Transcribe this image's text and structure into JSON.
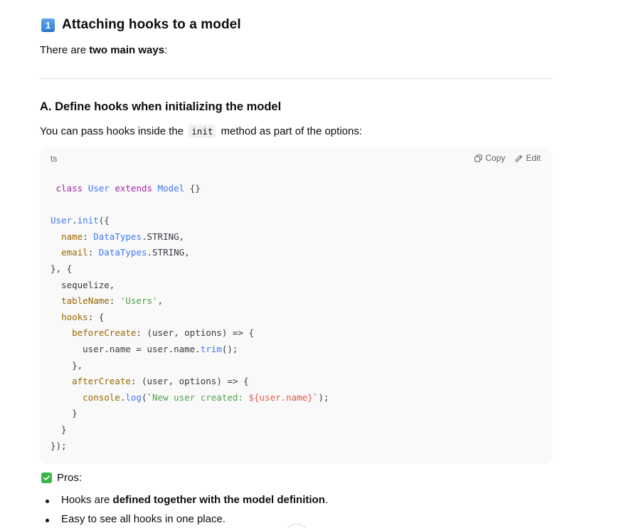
{
  "section": {
    "number_icon": "keycap-1",
    "title": "Attaching hooks to a model",
    "intro_prefix": "There are ",
    "intro_bold": "two main ways",
    "intro_suffix": ":"
  },
  "subsection": {
    "title": "A. Define hooks when initializing the model",
    "para_before": "You can pass hooks inside the ",
    "inline_code": "init",
    "para_after": " method as part of the options:"
  },
  "codeblock": {
    "language": "ts",
    "copy_label": "Copy",
    "edit_label": "Edit",
    "lines": [
      " class User extends Model {}",
      "",
      "User.init({",
      "  name: DataTypes.STRING,",
      "  email: DataTypes.STRING,",
      "}, {",
      "  sequelize,",
      "  tableName: 'Users',",
      "  hooks: {",
      "    beforeCreate: (user, options) => {",
      "      user.name = user.name.trim();",
      "    },",
      "    afterCreate: (user, options) => {",
      "      console.log(`New user created: ${user.name}`);",
      "    }",
      "  }",
      "});"
    ]
  },
  "pros": {
    "label": "Pros:",
    "items": [
      {
        "prefix": "Hooks are ",
        "bold": "defined together with the model definition",
        "suffix": "."
      },
      {
        "prefix": "Easy to see all hooks in one place.",
        "bold": "",
        "suffix": ""
      }
    ]
  },
  "colors": {
    "keyword": "#a626a4",
    "type": "#4078f2",
    "property": "#986801",
    "string": "#50a14f",
    "template_expr": "#e45649"
  }
}
